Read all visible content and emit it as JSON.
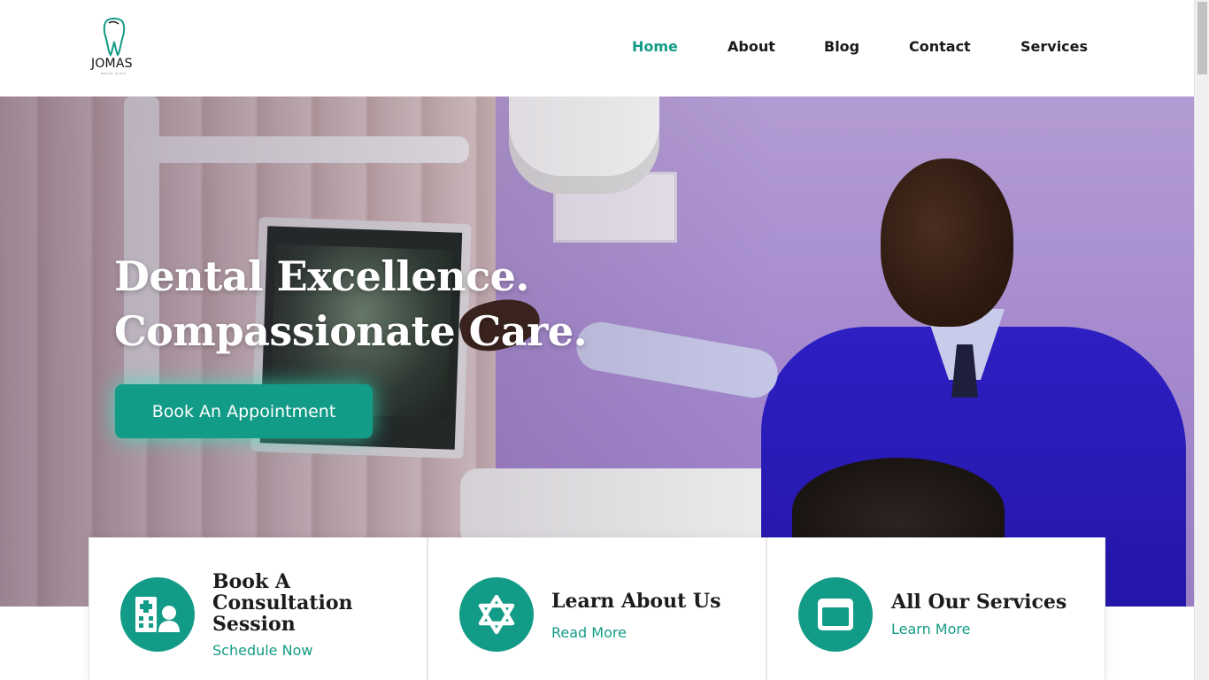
{
  "brand": {
    "name": "JOMAS",
    "tagline": "DENTAL CLINIC"
  },
  "nav": [
    {
      "label": "Home",
      "active": true
    },
    {
      "label": "About",
      "active": false
    },
    {
      "label": "Blog",
      "active": false
    },
    {
      "label": "Contact",
      "active": false
    },
    {
      "label": "Services",
      "active": false
    }
  ],
  "hero": {
    "headline_line1": "Dental Excellence.",
    "headline_line2": "Compassionate Care.",
    "cta_label": "Book An Appointment"
  },
  "cards": [
    {
      "title_lines": [
        "Book A",
        "Consultation",
        "Session"
      ],
      "link": "Schedule Now",
      "icon": "hospital-doctor-icon"
    },
    {
      "title_lines": [
        "Learn About Us"
      ],
      "link": "Read More",
      "icon": "star-of-david-icon"
    },
    {
      "title_lines": [
        "All Our Services"
      ],
      "link": "Learn More",
      "icon": "window-icon"
    }
  ],
  "colors": {
    "accent": "#129b86",
    "text": "#1c1c1c",
    "white": "#ffffff"
  }
}
